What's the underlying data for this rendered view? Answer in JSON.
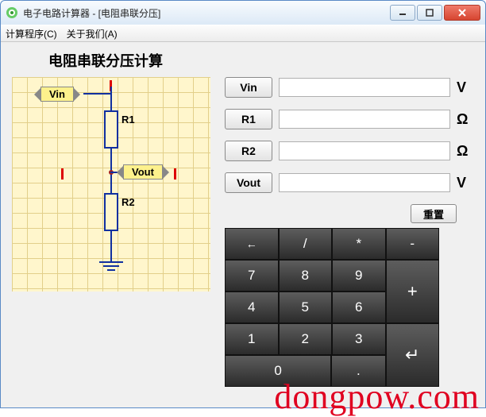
{
  "window": {
    "title": "电子电路计算器 - [电阻串联分压]"
  },
  "menu": {
    "calc": "计算程序(C)",
    "about": "关于我们(A)"
  },
  "heading": "电阻串联分压计算",
  "circuit": {
    "vin": "Vin",
    "vout": "Vout",
    "r1": "R1",
    "r2": "R2"
  },
  "fields": [
    {
      "label": "Vin",
      "value": "",
      "unit": "V"
    },
    {
      "label": "R1",
      "value": "",
      "unit": "Ω"
    },
    {
      "label": "R2",
      "value": "",
      "unit": "Ω"
    },
    {
      "label": "Vout",
      "value": "",
      "unit": "V"
    }
  ],
  "buttons": {
    "reset": "重置"
  },
  "keypad": {
    "backspace": "←",
    "divide": "/",
    "multiply": "*",
    "minus": "-",
    "plus": "+",
    "enter": "↵",
    "dot": ".",
    "digits": [
      "0",
      "1",
      "2",
      "3",
      "4",
      "5",
      "6",
      "7",
      "8",
      "9"
    ]
  },
  "watermark": "dongpow.com"
}
